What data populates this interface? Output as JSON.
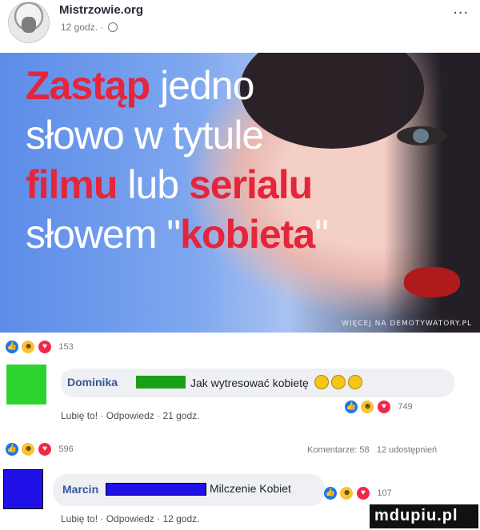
{
  "post": {
    "author": "Mistrzowie.org",
    "time": "12 godz. ·",
    "more": "..."
  },
  "hero": {
    "line1_a": "Zastąp",
    "line1_b": " jedno",
    "line2": "słowo w tytule",
    "line3_a": "filmu",
    "line3_b": " lub ",
    "line3_c": "serialu",
    "line4_a": "słowem \"",
    "line4_b": "kobieta",
    "line4_c": "\"",
    "watermark": "WIĘCEJ NA DEMOTYWATORY.PL"
  },
  "post_reactions": {
    "count": "153"
  },
  "comment1": {
    "author": "Dominika",
    "text": "Jak wytresować kobietę",
    "reactions_count": "749",
    "like": "Lubię to!",
    "reply": "Odpowiedz",
    "time": "21 godz."
  },
  "section2": {
    "reactions_count": "596",
    "comments": "Komentarze: 58",
    "shares": "12 udostępnień"
  },
  "comment2": {
    "author": "Marcin",
    "text": "Milczenie Kobiet",
    "reactions_count": "107",
    "like": "Lubię to!",
    "reply": "Odpowiedz",
    "time": "12 godz."
  },
  "watermark_badge": "mdupiu.pl",
  "icons": [
    "like-icon",
    "haha-icon",
    "love-icon",
    "globe-icon",
    "emoji-icon"
  ]
}
